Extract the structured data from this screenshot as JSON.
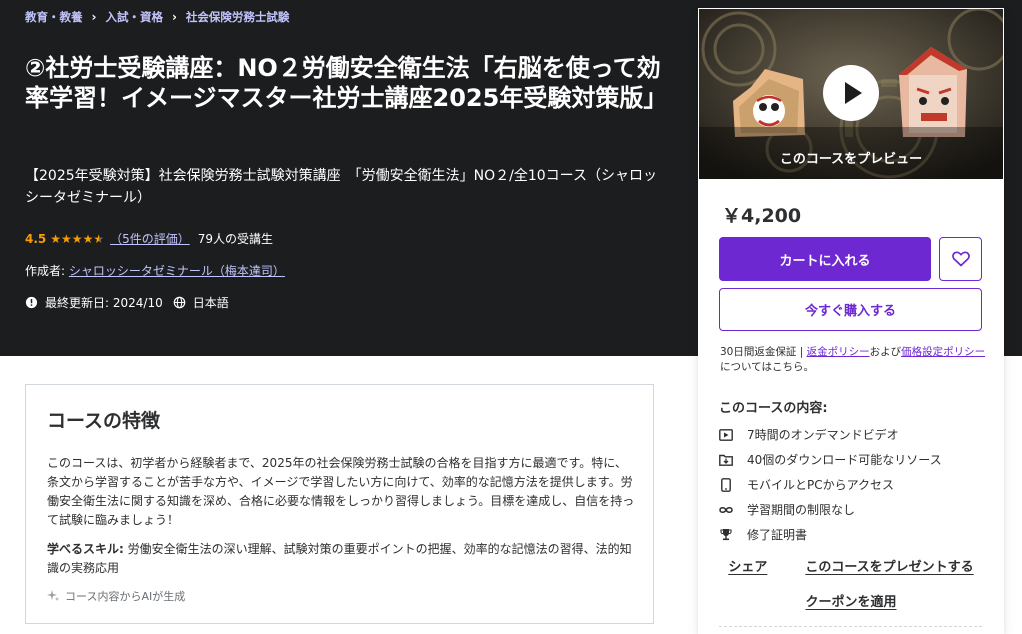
{
  "breadcrumb": [
    "教育・教養",
    "入試・資格",
    "社会保険労務士試験"
  ],
  "course": {
    "title": "②社労士受験講座：NO２労働安全衛生法「右脳を使って効率学習！イメージマスター社労士講座2025年受験対策版」",
    "subtitle": "【2025年受験対策】社会保険労務士試験対策講座　「労働安全衛生法」NO２/全10コース（シャロッシータゼミナール）",
    "rating": "4.5",
    "rating_value": 4.5,
    "reviews_link": "（5件の評価）",
    "students": "79人の受講生",
    "author_label": "作成者:",
    "author_name": "シャロッシータゼミナール（梅本達司）",
    "updated": "最終更新日: 2024/10",
    "language": "日本語"
  },
  "features": {
    "title": "コースの特徴",
    "description": "このコースは、初学者から経験者まで、2025年の社会保険労務士試験の合格を目指す方に最適です。特に、条文から学習することが苦手な方や、イメージで学習したい方に向けて、効率的な記憶方法を提供します。労働安全衛生法に関する知識を深め、合格に必要な情報をしっかり習得しましょう。目標を達成し、自信を持って試験に臨みましょう！",
    "skills_label": "学べるスキル:",
    "skills": " 労働安全衛生法の深い理解、試験対策の重要ポイントの把握、効率的な記憶法の習得、法的知識の実務応用",
    "ai_note": "コース内容からAIが生成"
  },
  "sidebar": {
    "preview_caption": "このコースをプレビュー",
    "price": "￥4,200",
    "add_to_cart": "カートに入れる",
    "buy_now": "今すぐ購入する",
    "policy_prefix": "30日間返金保証 | ",
    "refund_policy": "返金ポリシー",
    "policy_and": "および",
    "pricing_policy": "価格設定ポリシー",
    "policy_suffix": "についてはこちら。",
    "includes_title": "このコースの内容:",
    "includes": [
      {
        "icon": "video-icon",
        "text": "7時間のオンデマンドビデオ"
      },
      {
        "icon": "download-icon",
        "text": "40個のダウンロード可能なリソース"
      },
      {
        "icon": "mobile-icon",
        "text": "モバイルとPCからアクセス"
      },
      {
        "icon": "infinity-icon",
        "text": "学習期間の制限なし"
      },
      {
        "icon": "trophy-icon",
        "text": "修了証明書"
      }
    ],
    "share": "シェア",
    "gift": "このコースをプレゼントする",
    "coupon": "クーポンを適用"
  },
  "colors": {
    "hero_bg": "#1c1d1f",
    "accent": "#6d28d2",
    "star": "#f69c08",
    "link_light": "#c0c4fc"
  }
}
